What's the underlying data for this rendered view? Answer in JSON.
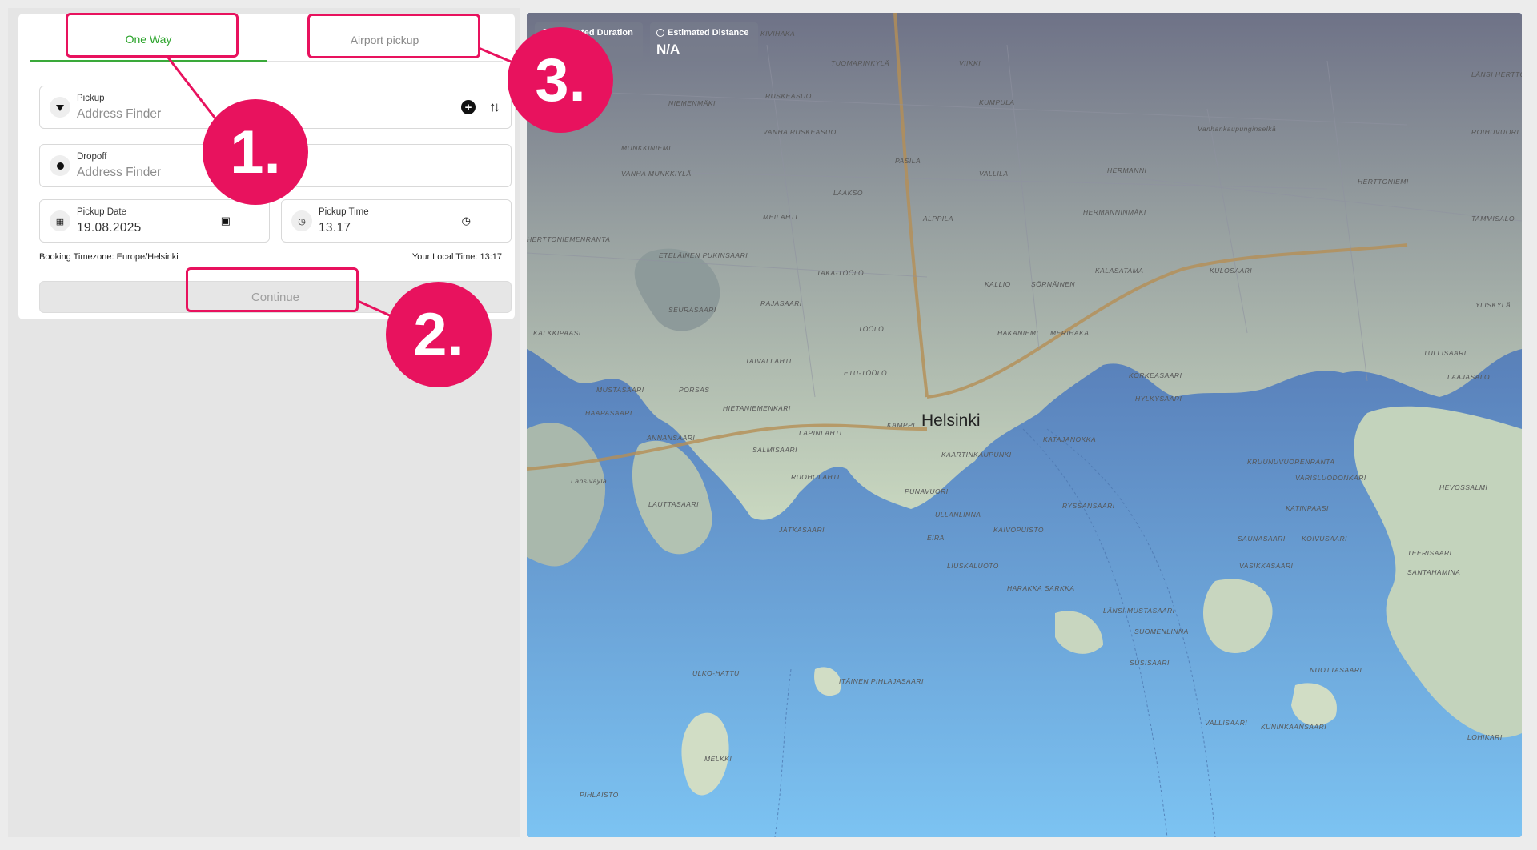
{
  "tabs": {
    "one_way": "One Way",
    "airport_pickup": "Airport pickup"
  },
  "pickup": {
    "label": "Pickup",
    "placeholder": "Address Finder"
  },
  "dropoff": {
    "label": "Dropoff",
    "placeholder": "Address Finder"
  },
  "pickup_date": {
    "label": "Pickup Date",
    "value": "19.08.2025"
  },
  "pickup_time": {
    "label": "Pickup Time",
    "value": "13.17"
  },
  "booking_timezone": "Booking Timezone: Europe/Helsinki",
  "local_time": "Your Local Time: 13:17",
  "continue_label": "Continue",
  "map": {
    "estimated_duration_label": "Estimated Duration",
    "estimated_distance_label": "Estimated Distance",
    "estimated_distance_value": "N/A",
    "city": "Helsinki",
    "places": [
      "KIVIHAKA",
      "TUOMARINKYLÄ",
      "VIIKKI",
      "NIEMENMÄKI",
      "RUSKEASUO",
      "KUMPULA",
      "VANHA RUSKEASUO",
      "HERMANNI",
      "MUNKKINIEMI",
      "PASILA",
      "VALLILA",
      "VANHA MUNKKIYLÄ",
      "LAAKSO",
      "ALPPILA",
      "HERMANNINMÄKI",
      "MEILAHTI",
      "KALASATAMA",
      "KULOSAARI",
      "ETELÄINEN PUKINSAARI",
      "TAKA-TÖÖLÖ",
      "KALLIO",
      "SÖRNÄINEN",
      "SEURASAARI",
      "RAJASAARI",
      "HAKANIEMI",
      "MERIHAKA",
      "KALKKIPAASI",
      "TÖÖLÖ",
      "TAIVALLAHTI",
      "ETU-TÖÖLÖ",
      "KORKEASAARI",
      "MUSTASAARI",
      "PORSAS",
      "HYLKYSAARI",
      "HAAPASAARI",
      "HIETANIEMENKARI",
      "KAMPPI",
      "KATAJANOKKA",
      "ANNANSAARI",
      "LAPINLAHTI",
      "SALMISAARI",
      "KAARTINKAUPUNKI",
      "RUOHOLAHTI",
      "PUNAVUORI",
      "LAUTTASAARI",
      "RYSSÄNSAARI",
      "JÄTKÄSAARI",
      "ULLANLINNA",
      "KAIVOPUISTO",
      "EIRA",
      "LIUSKALUOTO",
      "HARAKKA",
      "SARKKA",
      "LÄNSI MUSTASAARI",
      "SUOMENLINNA",
      "SUSISAARI",
      "ULKO-HATTU",
      "ITÄINEN PIHLAJASAARI",
      "MELKKI",
      "PIHLAISTO",
      "VALLISAARI",
      "KUNINKAANSAARI",
      "LÄNSI HERTTONIEMI",
      "HERTTONIEMI",
      "ROIHUVUORI",
      "TAMMISALO",
      "HERTTONIEMENRANTA",
      "YLISKYLÄ",
      "TULLISAARI",
      "LAAJASALO",
      "KRUUNUVUORENRANTA",
      "VARISLUODONKARI",
      "HEVOSSALMI",
      "KATINPAASI",
      "SAUNASAARI",
      "KOIVUSAARI",
      "VASIKKASAARI",
      "TEERISAARI",
      "SANTAHAMINA",
      "NUOTTASAARI",
      "LOHIKARI",
      "Vanhankaupunginselkä",
      "Länsiväylä"
    ]
  },
  "annotations": {
    "one": "1.",
    "two": "2.",
    "three": "3."
  },
  "colors": {
    "accent": "#e8125e",
    "tab_active": "#2aa32a"
  }
}
